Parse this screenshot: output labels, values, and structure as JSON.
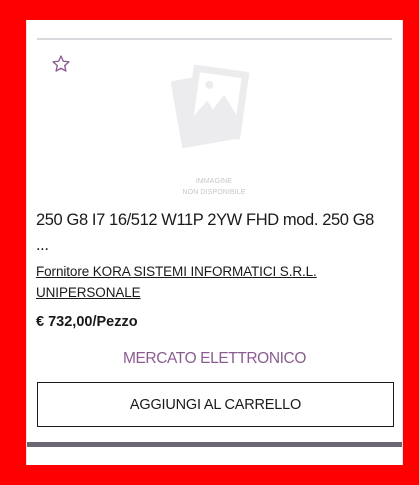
{
  "product_card": {
    "favorite_icon": "star-outline-icon",
    "placeholder_image": {
      "icon": "image-placeholder-icon",
      "line1": "IMMAGINE",
      "line2": "NON DISPONIBILE"
    },
    "title": "250 G8 I7 16/512 W11P 2YW FHD mod. 250 G8 ...",
    "supplier": "Fornitore KORA SISTEMI INFORMATICI S.R.L. UNIPERSONALE",
    "price": "€ 732,00/Pezzo",
    "market": "MERCATO ELETTRONICO",
    "add_to_cart_label": "AGGIUNGI AL CARRELLO"
  },
  "colors": {
    "background": "#ff0000",
    "accent_purple": "#8b5c91",
    "text": "#1a1a1a",
    "bottom_bar": "#6a6672"
  }
}
